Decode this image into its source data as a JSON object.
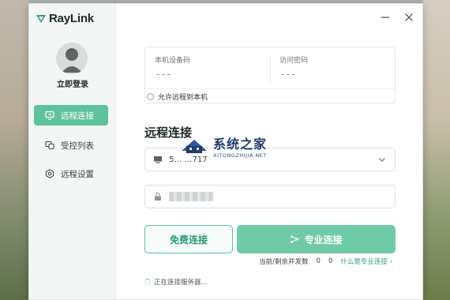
{
  "app": {
    "name": "RayLink",
    "brand_color": "#5ec39c"
  },
  "window_controls": [
    "minimize-icon",
    "close-icon"
  ],
  "sidebar": {
    "login_label": "立即登录",
    "items": [
      {
        "label": "远程连接",
        "icon": "remote-monitor-icon",
        "active": true
      },
      {
        "label": "受控列表",
        "icon": "device-list-icon",
        "active": false
      },
      {
        "label": "远程设置",
        "icon": "settings-hex-icon",
        "active": false
      }
    ]
  },
  "device_card": {
    "device_code_label": "本机设备码",
    "device_code_value": "---",
    "access_password_label": "访问密码",
    "access_password_value": "---",
    "allow_remote_label": "允许远程到本机"
  },
  "remote": {
    "section_title": "远程连接",
    "device_input_value": "5…  …717",
    "password_field": "masked",
    "free_button": "免费连接",
    "pro_button": "专业连接",
    "concurrency_label": "当前/剩余并发数",
    "concurrency_current": "0",
    "concurrency_remaining": "0",
    "pro_link": "什么是专业连接",
    "status_text": "正在连接服务器..."
  },
  "watermark": {
    "cn": "系统之家",
    "en": "XITONGZHIJIA.NET"
  }
}
